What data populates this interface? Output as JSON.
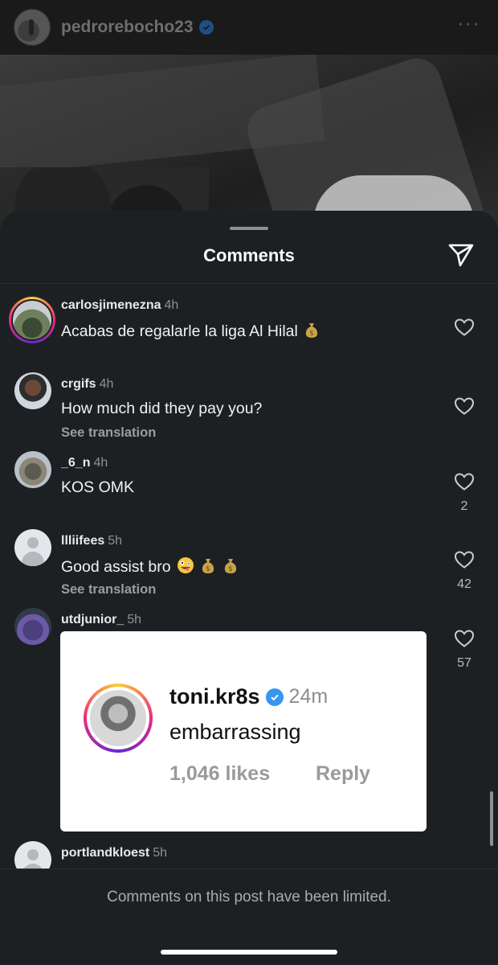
{
  "post": {
    "username": "pedrorebocho23",
    "more_icon": "ellipsis-icon"
  },
  "sheet": {
    "title": "Comments",
    "share_icon": "paper-plane-icon"
  },
  "comments": [
    {
      "username": "carlosjimenezna",
      "time": "4h",
      "text": "Acabas de regalarle la liga Al Hilal",
      "emoji": [
        "money-bag"
      ],
      "translation": "",
      "likes": ""
    },
    {
      "username": "crgifs",
      "time": "4h",
      "text": "How much did they pay you?",
      "translation": "See translation",
      "likes": ""
    },
    {
      "username": "_6_n",
      "time": "4h",
      "text": "KOS OMK",
      "translation": "",
      "likes": "2"
    },
    {
      "username": "llliifees",
      "time": "5h",
      "text": "Good assist bro",
      "emoji": [
        "zany-face",
        "money-bag",
        "money-bag"
      ],
      "translation": "See translation",
      "likes": "42"
    },
    {
      "username": "utdjunior_",
      "time": "5h",
      "text": "",
      "translation": "",
      "likes": "57"
    },
    {
      "username": "portlandkloest",
      "time": "5h",
      "text": "",
      "translation": "",
      "likes": ""
    }
  ],
  "embedded_comment": {
    "username": "toni.kr8s",
    "time": "24m",
    "text": "embarrassing",
    "likes": "1,046 likes",
    "reply": "Reply"
  },
  "footer": {
    "limited_text": "Comments on this post have been limited."
  },
  "colors": {
    "sheet_bg": "#1d2023",
    "verified_blue": "#3797f0",
    "story_ring": [
      "#f9ce34",
      "#ee2a7b",
      "#6228d7"
    ]
  }
}
